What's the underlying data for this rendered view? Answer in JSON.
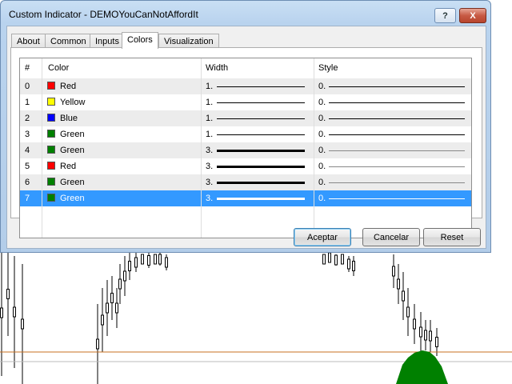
{
  "window": {
    "title": "Custom Indicator - DEMOYouCanNotAffordIt",
    "help_glyph": "?",
    "close_glyph": "X"
  },
  "tabs": [
    {
      "label": "About",
      "active": false
    },
    {
      "label": "Common",
      "active": false
    },
    {
      "label": "Inputs",
      "active": false
    },
    {
      "label": "Colors",
      "active": true
    },
    {
      "label": "Visualization",
      "active": false
    }
  ],
  "grid": {
    "headers": {
      "index": "#",
      "color": "Color",
      "width": "Width",
      "style": "Style"
    },
    "rows": [
      {
        "index": "0",
        "color_name": "Red",
        "swatch": "#ff0000",
        "width": "1.",
        "style": "0.",
        "selected": false
      },
      {
        "index": "1",
        "color_name": "Yellow",
        "swatch": "#ffff00",
        "width": "1.",
        "style": "0.",
        "selected": false
      },
      {
        "index": "2",
        "color_name": "Blue",
        "swatch": "#0000ff",
        "width": "1.",
        "style": "0.",
        "selected": false
      },
      {
        "index": "3",
        "color_name": "Green",
        "swatch": "#008000",
        "width": "1.",
        "style": "0.",
        "selected": false
      },
      {
        "index": "4",
        "color_name": "Green",
        "swatch": "#008000",
        "width": "3.",
        "style": "0.",
        "selected": false
      },
      {
        "index": "5",
        "color_name": "Red",
        "swatch": "#ff0000",
        "width": "3.",
        "style": "0.",
        "selected": false
      },
      {
        "index": "6",
        "color_name": "Green",
        "swatch": "#008000",
        "width": "3.",
        "style": "0.",
        "selected": false
      },
      {
        "index": "7",
        "color_name": "Green",
        "swatch": "#008000",
        "width": "3.",
        "style": "0.",
        "selected": true
      }
    ]
  },
  "buttons": {
    "ok": "Aceptar",
    "cancel": "Cancelar",
    "reset": "Reset"
  },
  "colors": {
    "selection": "#3399ff",
    "chart_level_line": "#c87020",
    "chart_fill": "#008000"
  }
}
